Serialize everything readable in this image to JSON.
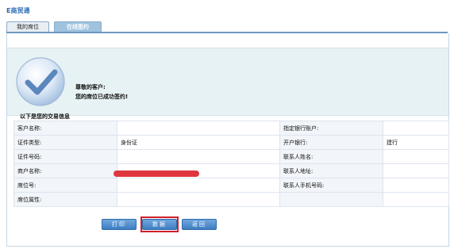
{
  "app": {
    "title": "E商贸通"
  },
  "tabs": [
    {
      "label": "我的席位"
    },
    {
      "label": "在线签约"
    }
  ],
  "success": {
    "greeting": "尊敬的客户:",
    "message": "您的席位已成功签约!"
  },
  "info": {
    "header": "以下是您的交易信息",
    "rows": [
      {
        "l1": "客户名称:",
        "v1": "",
        "l2": "指定银行账户:",
        "v2": ""
      },
      {
        "l1": "证件类型:",
        "v1": "身份证",
        "l2": "开户银行:",
        "v2": "建行"
      },
      {
        "l1": "证件号码:",
        "v1": "",
        "l2": "联系人姓名:",
        "v2": ""
      },
      {
        "l1": "商户名称:",
        "v1": "",
        "l2": "联系人地址:",
        "v2": ""
      },
      {
        "l1": "席位号:",
        "v1": "",
        "l2": "联系人手机号码:",
        "v2": ""
      },
      {
        "l1": "席位属性:",
        "v1": "",
        "l2": "",
        "v2": ""
      }
    ]
  },
  "buttons": {
    "print": "打印",
    "save": "数据",
    "back": "返回"
  },
  "colors": {
    "accent": "#2b6bb6",
    "success_bg": "#e7f2f4",
    "highlight": "#d1202a"
  }
}
